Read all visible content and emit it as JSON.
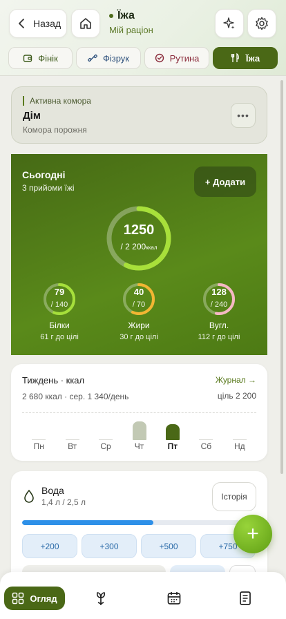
{
  "header": {
    "back_label": "Назад",
    "title": "Їжа",
    "subtitle": "Мій раціон",
    "icons": [
      "chevron-left-icon",
      "home-icon",
      "sparkle-icon",
      "gear-icon"
    ]
  },
  "tabs": [
    {
      "label": "Фінік",
      "icon": "wallet-icon",
      "active": false
    },
    {
      "label": "Фізрук",
      "icon": "dumbbell-icon",
      "active": false
    },
    {
      "label": "Рутина",
      "icon": "check-circle-icon",
      "active": false
    },
    {
      "label": "Їжа",
      "icon": "utensils-icon",
      "active": true
    }
  ],
  "pantry": {
    "label": "Активна комора",
    "name": "Дім",
    "status": "Комора порожня",
    "more": "•••"
  },
  "today": {
    "title": "Сьогодні",
    "subtitle": "3 прийоми їжі",
    "add_label": "+ Додати",
    "calories": "1250",
    "goal": "/ 2 200",
    "goal_unit": "ккал",
    "calories_progress": 0.57,
    "macros": [
      {
        "value": "79",
        "goal": "/ 140",
        "name": "Білки",
        "left": "61 г до цілі",
        "progress": 0.56,
        "color": "#a6e03a"
      },
      {
        "value": "40",
        "goal": "/ 70",
        "name": "Жири",
        "left": "30 г до цілі",
        "progress": 0.57,
        "color": "#f2b632"
      },
      {
        "value": "128",
        "goal": "/ 240",
        "name": "Вугл.",
        "left": "112 г до цілі",
        "progress": 0.53,
        "color": "#f5b8c4"
      }
    ]
  },
  "week": {
    "title": "Тиждень · ккал",
    "journal_label": "Журнал →",
    "summary": "2 680 ккал · сер. 1 340/день",
    "goal": "ціль 2 200",
    "days": [
      "Пн",
      "Вт",
      "Ср",
      "Чт",
      "Пт",
      "Сб",
      "Нд"
    ],
    "active_day": "Пт",
    "values": [
      0,
      0,
      0,
      1430,
      1250,
      0,
      0
    ]
  },
  "water": {
    "title": "Вода",
    "amount": "1,4 л / 2,5 л",
    "history_label": "Історія",
    "progress": 0.56,
    "buttons": [
      "+200",
      "+300",
      "+500",
      "+750"
    ]
  },
  "fab_label": "+",
  "nav": {
    "active_label": "Огляд",
    "icons": [
      "grid-icon",
      "plant-icon",
      "calendar-icon",
      "book-icon"
    ]
  },
  "colors": {
    "accent": "#4a6816",
    "card_green": "#5a8a1a",
    "water_blue": "#2e90e8"
  }
}
